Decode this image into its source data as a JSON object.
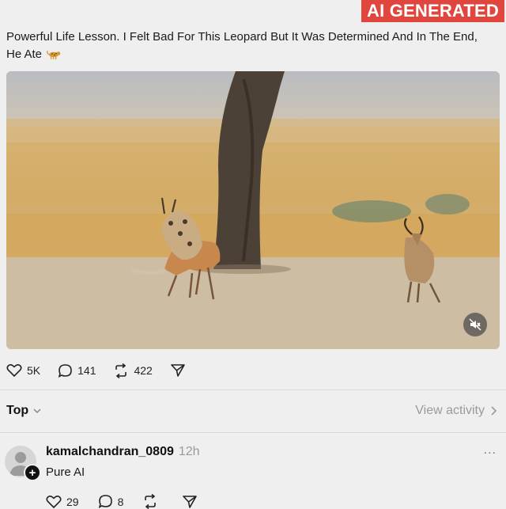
{
  "badge": {
    "label": "AI GENERATED"
  },
  "post": {
    "caption": "Powerful Life Lesson. I Felt Bad For This Leopard But It Was Determined And In The End, He Ate",
    "emoji": "leopard-emoji",
    "video": {
      "muted": true,
      "mute_icon": "speaker-muted-icon"
    },
    "actions": {
      "likes": "5K",
      "replies": "141",
      "reposts": "422"
    }
  },
  "sort_bar": {
    "sort_label": "Top",
    "view_activity_label": "View activity"
  },
  "comment": {
    "username": "kamalchandran_0809",
    "time": "12h",
    "more": "...",
    "text": "Pure AI",
    "likes": "29",
    "replies": "8"
  },
  "colors": {
    "badge_bg": "#e0463e",
    "background": "#efefef",
    "muted_text": "#9a9a9a"
  }
}
